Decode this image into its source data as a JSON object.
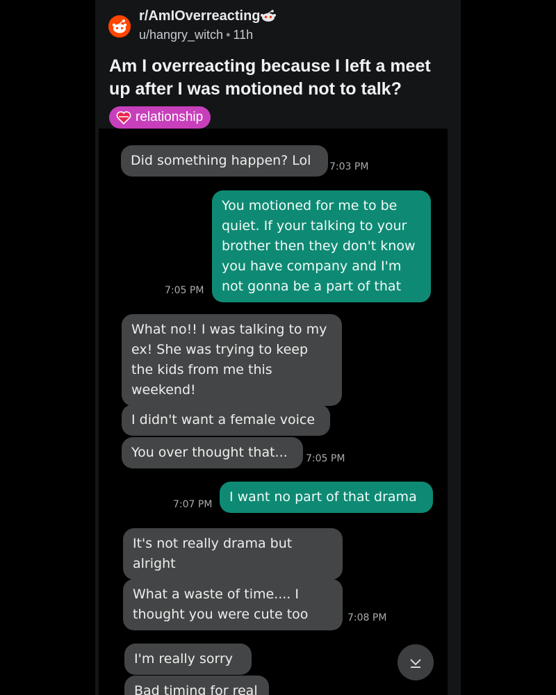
{
  "post": {
    "subreddit": "r/AmIOverreacting",
    "username": "u/hangry_witch",
    "separator": "•",
    "age": "11h",
    "title": "Am I overreacting because I left a meet up after I was motioned not to talk?",
    "flair": "relationship"
  },
  "colors": {
    "flair_bg": "#c83fbb",
    "sent_bubble": "#0e8a74",
    "received_bubble": "#444546",
    "subreddit_icon": "#ff4500"
  },
  "messages": [
    {
      "dir": "received",
      "text": "Did something happen? Lol"
    },
    {
      "dir": "sent",
      "text": "You motioned for me to be quiet. If your talking to your brother then they don't know you have company and I'm not gonna be a part of that"
    },
    {
      "dir": "received",
      "text": "What no!! I was talking to my ex! She was trying to keep the kids from me this weekend!"
    },
    {
      "dir": "received",
      "text": "I didn't want a female voice"
    },
    {
      "dir": "received",
      "text": "You over thought that..."
    },
    {
      "dir": "sent",
      "text": "I want no part of that drama"
    },
    {
      "dir": "received",
      "text": "It's not really drama but alright"
    },
    {
      "dir": "received",
      "text": "What a waste of time.... I thought you were cute too"
    },
    {
      "dir": "received",
      "text": "I'm really sorry"
    },
    {
      "dir": "received",
      "text": "Bad timing for real"
    }
  ],
  "timestamps": [
    "7:03 PM",
    "7:05 PM",
    "7:05 PM",
    "7:07 PM",
    "7:08 PM"
  ],
  "icons": {
    "subreddit": "reddit-snoo-icon",
    "emoji": "snoo-emoji-icon",
    "flair": "heart-icon",
    "scroll": "chevron-down-icon"
  }
}
